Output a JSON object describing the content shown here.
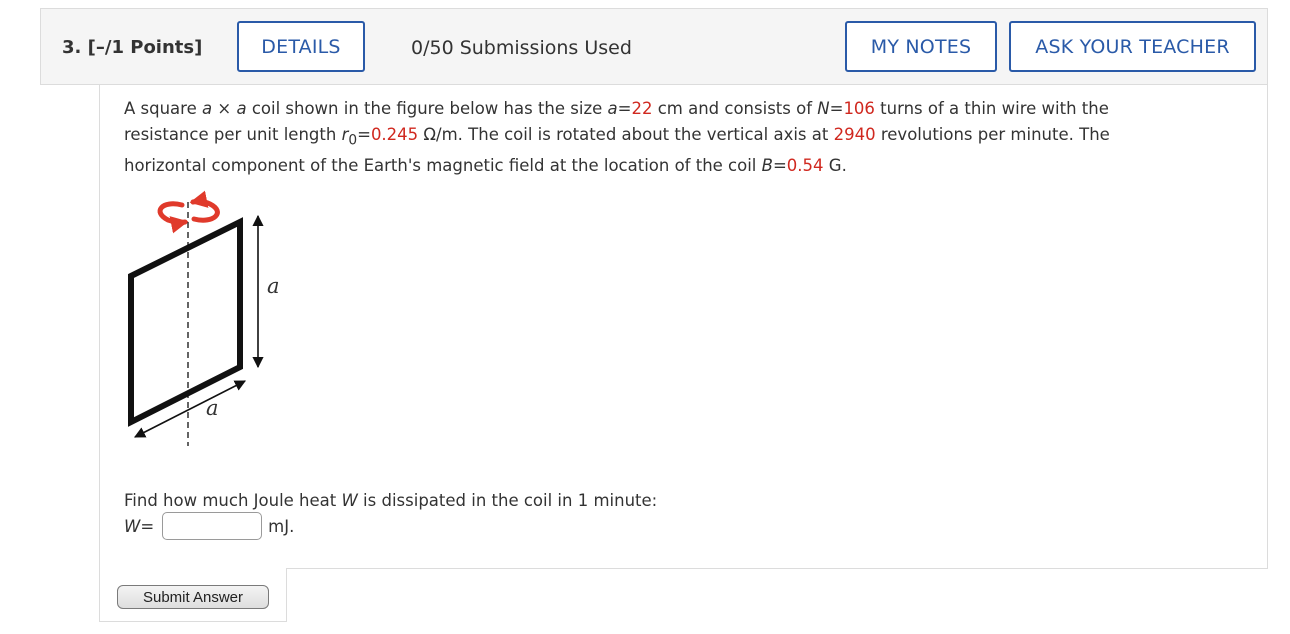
{
  "header": {
    "question_number": "3.",
    "points": "[–/1 Points]",
    "details_label": "DETAILS",
    "submissions": "0/50 Submissions Used",
    "my_notes_label": "MY NOTES",
    "ask_teacher_label": "ASK YOUR TEACHER"
  },
  "problem": {
    "t1": "A square ",
    "a1": "a",
    "t2": " × ",
    "a2": "a",
    "t3": " coil shown in the figure below has the size ",
    "a3": "a",
    "t4": "=",
    "size_value": "22",
    "t5": " cm and consists of ",
    "n": "N",
    "t6": "=",
    "turns_value": "106",
    "t7": " turns of a thin wire with the resistance per unit length ",
    "r": "r",
    "r_sub": "0",
    "t8": "=",
    "resistance_value": "0.245",
    "t9": " Ω/m. The coil is rotated about the vertical axis at ",
    "rpm_value": "2940",
    "t10": " revolutions per minute. The horizontal component of the Earth's magnetic field at the location of the coil ",
    "b": "B",
    "t11": "=",
    "field_value": "0.54",
    "t12": " G."
  },
  "figure": {
    "label_vertical": "a",
    "label_horizontal": "a"
  },
  "question": {
    "prompt_pre": "Find how much Joule heat ",
    "w": "W",
    "prompt_post": " is dissipated in the coil in 1 minute:",
    "answer_label_var": "W",
    "answer_label_eq": "=",
    "answer_value": "",
    "unit": "mJ."
  },
  "submit": {
    "label": "Submit Answer"
  },
  "colors": {
    "accent": "#2a5aa8",
    "value_red": "#d0281f",
    "arrow_red": "#e03a2b"
  }
}
